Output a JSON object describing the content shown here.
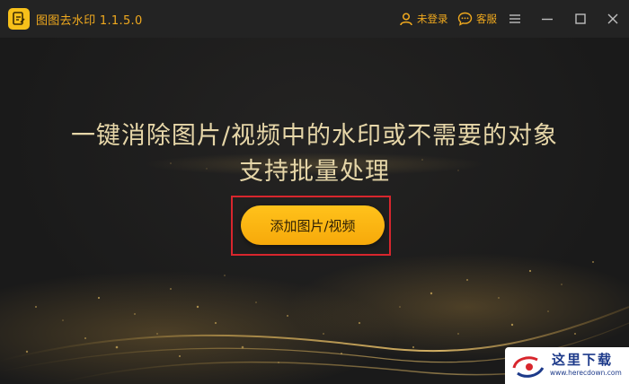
{
  "app": {
    "title": "图图去水印  1.1.5.0",
    "logo_icon": "notebook-pen-icon"
  },
  "header": {
    "login_label": "未登录",
    "login_icon": "user-icon",
    "service_label": "客服",
    "service_icon": "chat-bubble-icon",
    "menu_icon": "hamburger-menu-icon",
    "minimize_icon": "minimize-icon",
    "maximize_icon": "maximize-icon",
    "close_icon": "close-icon"
  },
  "main": {
    "headline_line1": "一键消除图片/视频中的水印或不需要的对象",
    "headline_line2": "支持批量处理",
    "add_button_label": "添加图片/视频"
  },
  "watermark": {
    "text": "这里下载",
    "url": "www.herecdown.com"
  },
  "colors": {
    "accent": "#f0a91e",
    "button": "#ffb915",
    "highlight_border": "#d8262d",
    "headline": "#e6d6a8",
    "background": "#1b1b1b"
  }
}
